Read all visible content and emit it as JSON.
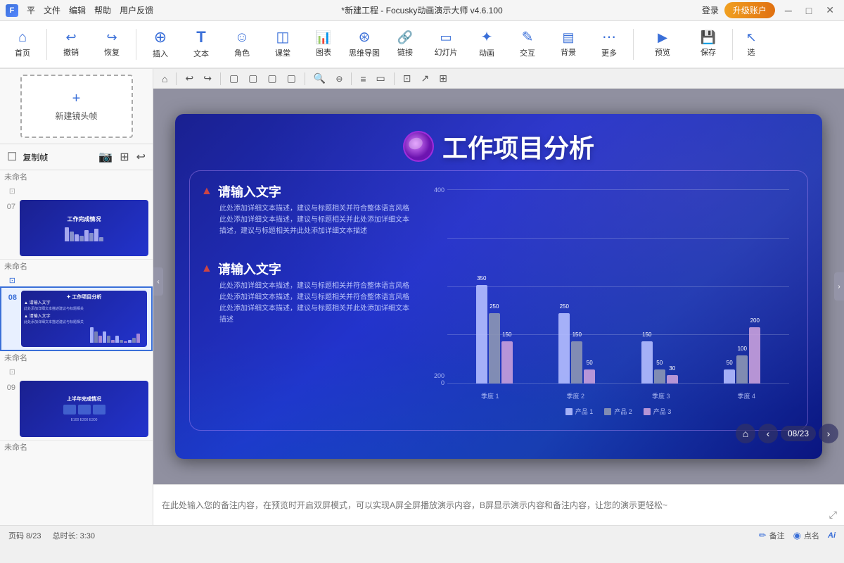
{
  "titlebar": {
    "sys_icon": "F",
    "menus": [
      "平",
      "文件",
      "编辑",
      "帮助",
      "用户反馈"
    ],
    "title": "*新建工程 - Focusky动画演示大师  v4.6.100",
    "login": "登录",
    "upgrade": "升级账户",
    "win_min": "─",
    "win_max": "□",
    "win_close": "✕"
  },
  "toolbar": {
    "items": [
      {
        "id": "home",
        "icon": "⌂",
        "label": "首页"
      },
      {
        "id": "undo",
        "icon": "↩",
        "label": "撤销"
      },
      {
        "id": "redo",
        "icon": "↪",
        "label": "恢复"
      },
      {
        "id": "insert",
        "icon": "+",
        "label": "插入"
      },
      {
        "id": "text",
        "icon": "T",
        "label": "文本"
      },
      {
        "id": "character",
        "icon": "☺",
        "label": "角色"
      },
      {
        "id": "classroom",
        "icon": "◫",
        "label": "课堂"
      },
      {
        "id": "chart",
        "icon": "📊",
        "label": "图表"
      },
      {
        "id": "mindmap",
        "icon": "⊛",
        "label": "思维导图"
      },
      {
        "id": "link",
        "icon": "🔗",
        "label": "链接"
      },
      {
        "id": "slide",
        "icon": "▭",
        "label": "幻灯片"
      },
      {
        "id": "animation",
        "icon": "✦",
        "label": "动画"
      },
      {
        "id": "interact",
        "icon": "✎",
        "label": "交互"
      },
      {
        "id": "background",
        "icon": "▤",
        "label": "背景"
      },
      {
        "id": "more",
        "icon": "⋯",
        "label": "更多"
      },
      {
        "id": "preview",
        "icon": "▶",
        "label": "预览"
      },
      {
        "id": "save",
        "icon": "💾",
        "label": "保存"
      },
      {
        "id": "select",
        "icon": "↖",
        "label": "选"
      }
    ]
  },
  "sidebar": {
    "new_frame_label": "新建镜头帧",
    "copy_btn": "复制帧",
    "tools": [
      "📷",
      "⊞",
      "↩"
    ],
    "slides": [
      {
        "num": "07",
        "name": "未命名",
        "type": "chart"
      },
      {
        "num": "08",
        "name": "未命名",
        "type": "current"
      },
      {
        "num": "09",
        "name": "未命名",
        "type": "table"
      }
    ]
  },
  "canvas": {
    "toolbar_icons": [
      "⌂",
      "|",
      "↩",
      "↩",
      "|",
      "▢",
      "▢",
      "▢",
      "▢",
      "|",
      "🔍+",
      "🔍-",
      "|",
      "≡",
      "▭",
      "|",
      "⊡",
      "↗",
      "⊞"
    ],
    "slide": {
      "logo_text": "●",
      "title": "工作项目分析",
      "section1_title": "请输入文字",
      "section1_icon": "▲",
      "section1_body": "此处添加详细文本描述，建议与标题相关并符合整体语言风格此处添加详细文本描述，建议与标题相关并此处添加详细文本描述，建议与标题相关并此处添加详细文本描述",
      "section2_title": "请输入文字",
      "section2_icon": "▲",
      "section2_body": "此处添加详细文本描述，建议与标题相关并符合整体语言风格此处添加详细文本描述，建议与标题相关并符合整体语言风格此处添加详细文本描述，建议与标题相关并此处添加详细文本描述",
      "chart": {
        "y_labels": [
          "400",
          "200",
          "0"
        ],
        "x_labels": [
          "季度 1",
          "季度 2",
          "季度 3",
          "季度 4"
        ],
        "groups": [
          {
            "label": "季度 1",
            "p1": 350,
            "p2": 250,
            "p3": 150
          },
          {
            "label": "季度 2",
            "p1": 250,
            "p2": 150,
            "p3": 50
          },
          {
            "label": "季度 3",
            "p1": 150,
            "p2": 50,
            "p3": 30
          },
          {
            "label": "季度 4",
            "p1": 50,
            "p2": 100,
            "p3": 200
          }
        ],
        "max": 400,
        "legend": [
          "产品 1",
          "产品 2",
          "产品 3"
        ],
        "bar_values": {
          "g1": {
            "p1": "350",
            "p2": "250",
            "p3": "150"
          },
          "g2": {
            "p1": "250",
            "p2": "150",
            "p3": "50"
          },
          "g3": {
            "p1": "150",
            "p2": "50",
            "p3": "30"
          },
          "g4": {
            "p1": "50",
            "p2": "100",
            "p3": "200"
          }
        }
      }
    }
  },
  "notes": {
    "placeholder": "在此处输入您的备注内容，在预览时开启双屏模式，可以实现A屏全屏播放演示内容，B屏显示演示内容和备注内容，让您的演示更轻松~"
  },
  "navigation": {
    "page": "08/23",
    "home_icon": "⌂",
    "prev_icon": "‹",
    "next_icon": "›"
  },
  "statusbar": {
    "page_info": "页码 8/23",
    "duration": "总时长: 3:30",
    "notes_btn": "备注",
    "points_btn": "点名",
    "ai_text": "Ai"
  }
}
